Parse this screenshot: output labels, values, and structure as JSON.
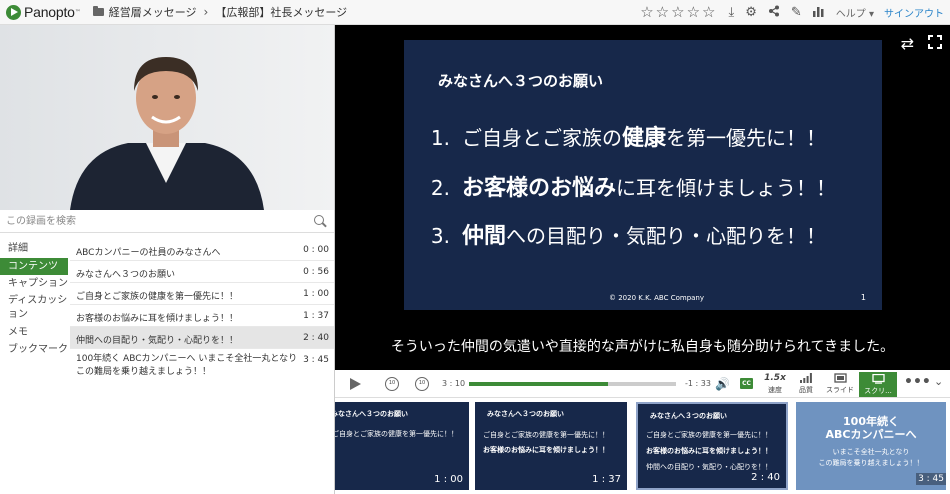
{
  "app": {
    "logo": "Panopto",
    "breadcrumb": [
      "経営層メッセージ",
      "【広報部】社長メッセージ"
    ],
    "help_label": "ヘルプ",
    "signin_label": "サインアウト",
    "rating": {
      "stars": 5,
      "filled": 0
    }
  },
  "search": {
    "placeholder": "この録画を検索"
  },
  "tabs": [
    "詳細",
    "コンテンツ",
    "キャプション",
    "ディスカッション",
    "メモ",
    "ブックマーク"
  ],
  "active_tab": "コンテンツ",
  "contents": [
    {
      "title": "ABCカンパニーの社員のみなさんへ",
      "time": "0 : 00"
    },
    {
      "title": "みなさんへ３つのお願い",
      "time": "0 : 56"
    },
    {
      "title": "ご自身とご家族の健康を第一優先に！！",
      "time": "1 : 00"
    },
    {
      "title": "お客様のお悩みに耳を傾けましょう！！",
      "time": "1 : 37"
    },
    {
      "title": "仲間への目配り・気配り・心配りを！！",
      "time": "2 : 40"
    },
    {
      "title": "100年続く ABCカンパニーへ いまこそ全社一丸となり この難局を乗り越えましょう！！",
      "time": "3 : 45"
    }
  ],
  "selected_content_index": 4,
  "slide": {
    "heading": "みなさんへ３つのお願い",
    "items": [
      {
        "num": "1.",
        "pre": "ご自身とご家族の",
        "bold": "健康",
        "post": "を第一優先に！！"
      },
      {
        "num": "2.",
        "pre": "",
        "bold": "お客様のお悩み",
        "post": "に耳を傾けましょう！！"
      },
      {
        "num": "3.",
        "pre": "",
        "bold": "仲間",
        "post": "への目配り・気配り・心配りを！！"
      }
    ],
    "copyright": "© 2020 K.K. ABC Company",
    "page": "1"
  },
  "caption": "そういった仲間の気遣いや直接的な声がけに私自身も随分助けられてきました。",
  "player": {
    "current_time": "3 : 10",
    "remaining_time": "-1 : 33",
    "progress": 0.67,
    "rewind_label": "10",
    "forward_label": "10",
    "cc_label": "CC",
    "speed_value": "1.5x",
    "speed_label": "速度",
    "quality_label": "品質",
    "slides_label": "スライド",
    "screen_label": "スクリ...",
    "more_label": "•••"
  },
  "thumbnails": [
    {
      "head": "みなさんへ３つのお願い",
      "line1": "ご自身とご家族の健康を第一優先に！！",
      "time": "1 : 00"
    },
    {
      "head": "みなさんへ３つのお願い",
      "line1": "ご自身とご家族の健康を第一優先に！！",
      "line2": "お客様のお悩みに耳を傾けましょう！！",
      "time": "1 : 37"
    },
    {
      "head": "みなさんへ３つのお願い",
      "line1": "ご自身とご家族の健康を第一優先に！！",
      "line2": "お客様のお悩みに耳を傾けましょう！！",
      "line3": "仲間への目配り・気配り・心配りを！！",
      "time": "2 : 40"
    },
    {
      "title1": "100年続く",
      "title2": "ABCカンパニーへ",
      "sub1": "いまこそ全社一丸となり",
      "sub2": "この難局を乗り越えましょう！！",
      "time": "3 : 45"
    }
  ],
  "colors": {
    "accent": "#3d8b37",
    "slide_bg": "#17284a",
    "link": "#2a84c9"
  }
}
